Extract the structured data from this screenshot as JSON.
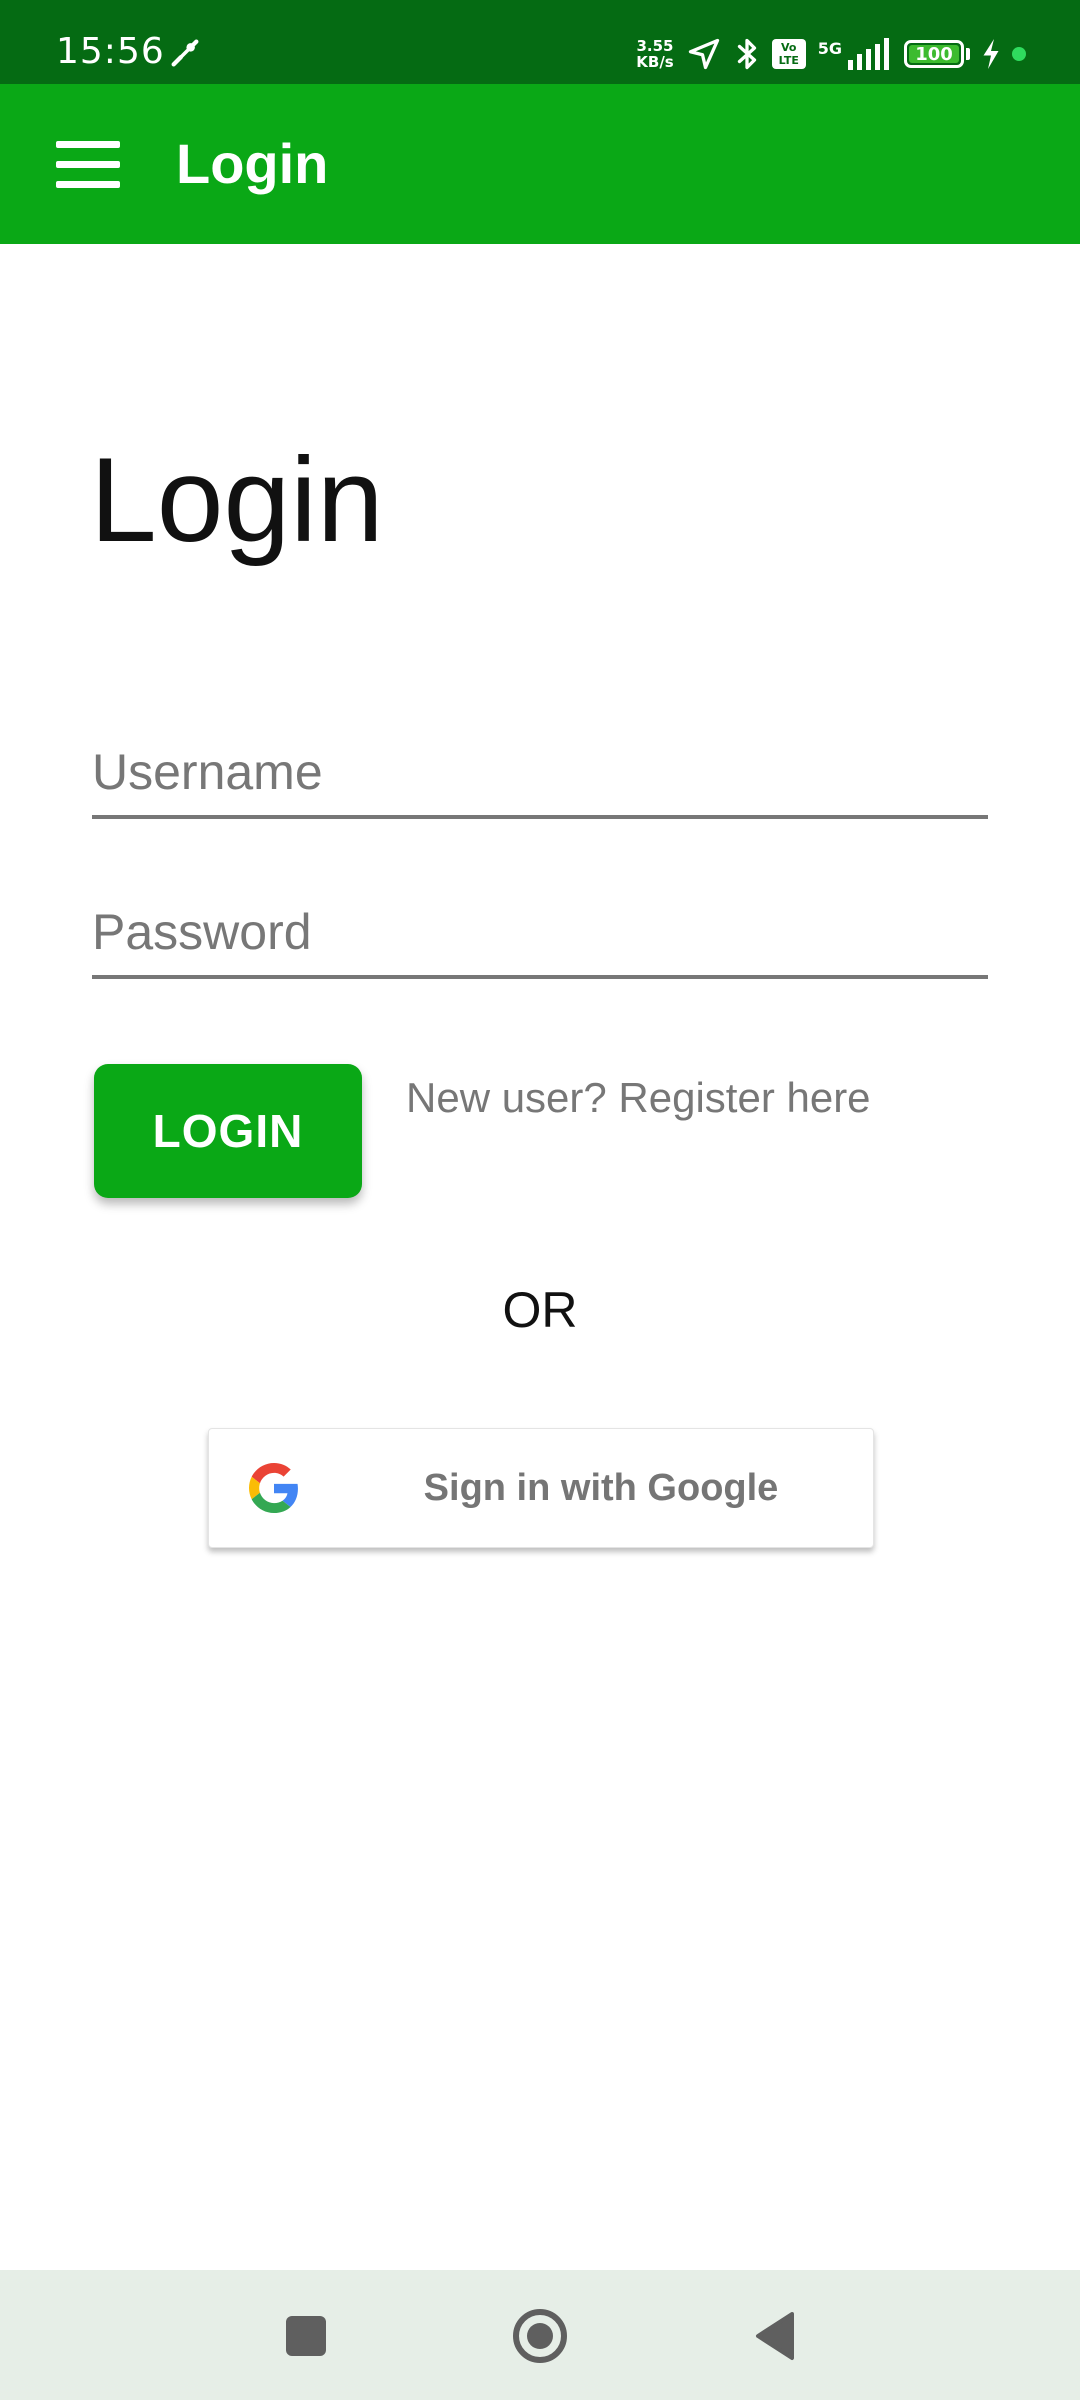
{
  "status_bar": {
    "time": "15:56",
    "speed_value": "3.55",
    "speed_unit": "KB/s",
    "volte_top": "Vo",
    "volte_bottom": "LTE",
    "network": "5G",
    "battery": "100"
  },
  "app_bar": {
    "title": "Login"
  },
  "page": {
    "title": "Login"
  },
  "form": {
    "username_placeholder": "Username",
    "username_value": "",
    "password_placeholder": "Password",
    "password_value": "",
    "login_button": "LOGIN",
    "register_link": "New user? Register here",
    "or_separator": "OR",
    "google_button": "Sign in with Google"
  },
  "colors": {
    "status_bar": "#056b13",
    "primary": "#0aa816",
    "nav_bar": "#e6eee7"
  }
}
